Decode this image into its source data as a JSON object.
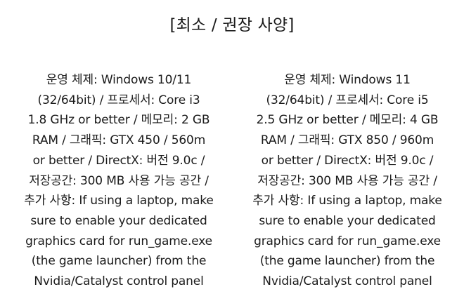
{
  "title": "[최소 / 권장 사양]",
  "minimum": {
    "lines": [
      "운영 체제: Windows 10/11",
      "(32/64bit) / 프로세서: Core i3",
      "1.8 GHz or better / 메모리: 2 GB",
      "RAM / 그래픽: GTX 450 / 560m",
      "or better / DirectX: 버전 9.0c /",
      "저장공간: 300 MB 사용 가능 공간 /",
      "추가 사항: If using a laptop, make",
      "sure to enable your dedicated",
      "graphics card for run_game.exe",
      "(the game launcher) from the",
      "Nvidia/Catalyst control panel"
    ]
  },
  "recommended": {
    "lines": [
      "운영 체제: Windows 11",
      "(32/64bit) / 프로세서: Core i5",
      "2.5 GHz or better / 메모리: 4 GB",
      "RAM / 그래픽: GTX 850 / 960m",
      "or better / DirectX: 버전 9.0c /",
      "저장공간: 300 MB 사용 가능 공간 /",
      "추가 사항: If using a laptop, make",
      "sure to enable your dedicated",
      "graphics card for run_game.exe",
      "(the game launcher) from the",
      "Nvidia/Catalyst control panel"
    ]
  }
}
